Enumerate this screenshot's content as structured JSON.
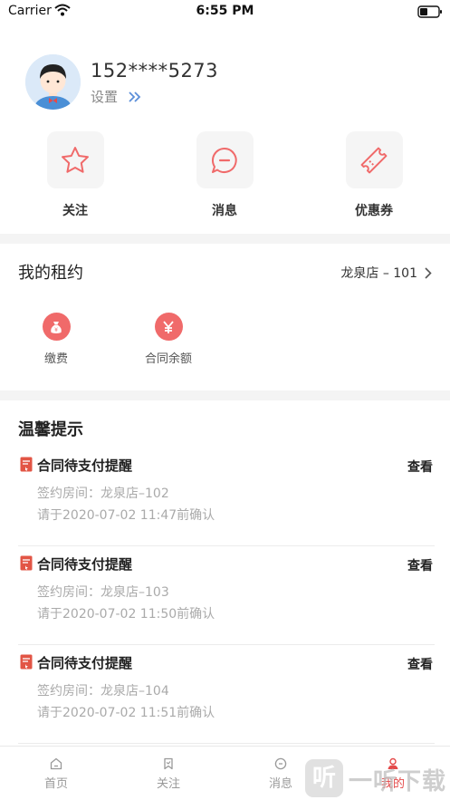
{
  "status_bar": {
    "carrier": "Carrier",
    "time": "6:55 PM"
  },
  "profile": {
    "phone": "152****5273",
    "settings_label": "设置"
  },
  "quick_actions": [
    {
      "label": "关注",
      "icon": "star-icon"
    },
    {
      "label": "消息",
      "icon": "message-icon"
    },
    {
      "label": "优惠券",
      "icon": "coupon-icon"
    }
  ],
  "lease": {
    "title": "我的租约",
    "store": "龙泉店 – 101",
    "actions": [
      {
        "label": "缴费",
        "icon": "money-bag-icon"
      },
      {
        "label": "合同余额",
        "icon": "yen-icon"
      }
    ]
  },
  "tips": {
    "title": "温馨提示",
    "items": [
      {
        "title": "合同待支付提醒",
        "view_label": "查看",
        "room": "签约房间：龙泉店–102",
        "deadline": "请于2020-07-02 11:47前确认"
      },
      {
        "title": "合同待支付提醒",
        "view_label": "查看",
        "room": "签约房间：龙泉店–103",
        "deadline": "请于2020-07-02 11:50前确认"
      },
      {
        "title": "合同待支付提醒",
        "view_label": "查看",
        "room": "签约房间：龙泉店–104",
        "deadline": "请于2020-07-02 11:51前确认"
      }
    ]
  },
  "tabbar": {
    "items": [
      {
        "label": "首页",
        "icon": "home-icon"
      },
      {
        "label": "关注",
        "icon": "bookmark-icon"
      },
      {
        "label": "消息",
        "icon": "chat-icon"
      },
      {
        "label": "我的",
        "icon": "user-icon"
      }
    ],
    "active_index": 3
  },
  "watermark": {
    "badge": "听",
    "text": "一听下载"
  },
  "colors": {
    "accent": "#e44a4a",
    "icon_red": "#f06a6a",
    "separator": "#f4f4f4"
  }
}
